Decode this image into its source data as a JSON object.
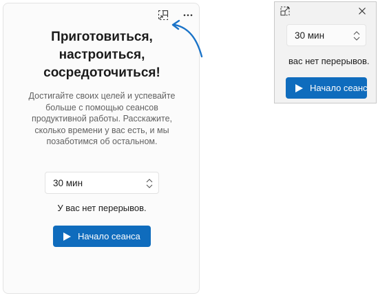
{
  "colors": {
    "accent": "#0f6cbd",
    "arrow": "#1a73c8",
    "text_secondary": "#616161"
  },
  "icons": {
    "compact_mode": "compact-mode-icon",
    "more": "more-horizontal-icon",
    "expand": "expand-icon",
    "close": "close-icon",
    "stepper": "up-down-chevron-icon",
    "play": "play-icon"
  },
  "main": {
    "heading_lines": [
      "Приготовиться,",
      "настроиться,",
      "сосредоточиться!"
    ],
    "description": "Достигайте своих целей и успевайте больше с помощью сеансов продуктивной работы. Расскажите, сколько времени у вас есть, и мы позаботимся об остальном.",
    "duration_value": "30 мин",
    "break_info": "У вас нет перерывов.",
    "start_label": "Начало сеанса"
  },
  "mini": {
    "duration_value": "30 мин",
    "break_info": "вас нет перерывов.",
    "start_label": "Начало сеанса"
  }
}
